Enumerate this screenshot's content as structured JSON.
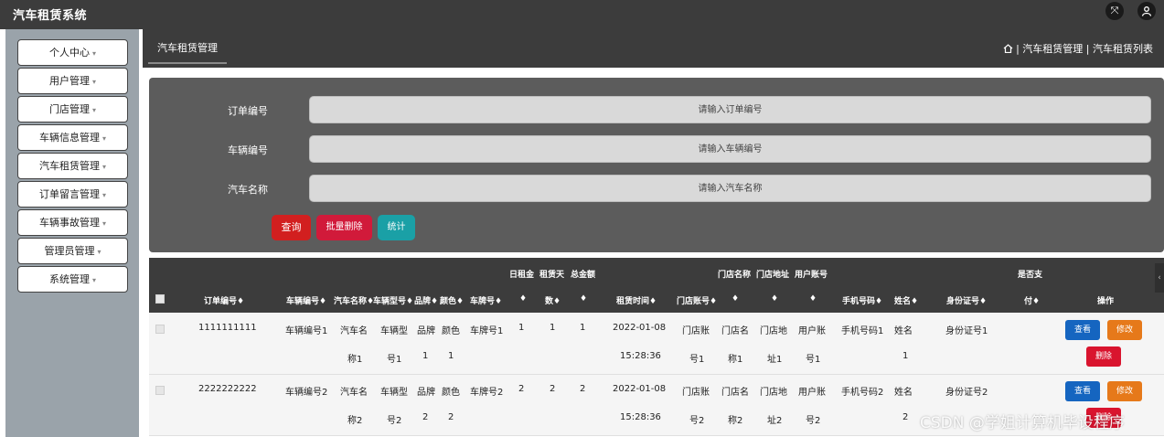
{
  "app": {
    "title": "汽车租赁系统"
  },
  "topbar": {
    "fullscreen_icon": "fullscreen-icon",
    "user_icon": "user-icon"
  },
  "sidebar": {
    "items": [
      {
        "label": "个人中心"
      },
      {
        "label": "用户管理"
      },
      {
        "label": "门店管理"
      },
      {
        "label": "车辆信息管理"
      },
      {
        "label": "汽车租赁管理"
      },
      {
        "label": "订单留言管理"
      },
      {
        "label": "车辆事故管理"
      },
      {
        "label": "管理员管理"
      },
      {
        "label": "系统管理"
      }
    ],
    "caret": "▾"
  },
  "tab": {
    "label": "汽车租赁管理"
  },
  "breadcrumb": {
    "sep": "|",
    "level1": "汽车租赁管理",
    "level2": "汽车租赁列表"
  },
  "search": {
    "order_label": "订单编号",
    "order_placeholder": "请输入订单编号",
    "vehicle_label": "车辆编号",
    "vehicle_placeholder": "请输入车辆编号",
    "car_name_label": "汽车名称",
    "car_name_placeholder": "请输入汽车名称",
    "query_button": "查询",
    "batch_delete_button": "批量删除",
    "stats_button": "统计"
  },
  "table": {
    "headers": {
      "daily_rent": "日租金",
      "rent_days": "租赁天",
      "total": "总金额",
      "store_name": "门店名称",
      "store_addr": "门店地址",
      "user_acct": "用户账号",
      "paid": "是否支",
      "order_no": "订单编号",
      "vehicle_no": "车辆编号",
      "car_name": "汽车名称",
      "car_model": "车辆型号",
      "brand": "品牌",
      "color": "颜色",
      "plate": "车牌号",
      "days_suffix": "数",
      "rent_time": "租赁时间",
      "store_acct": "门店账号",
      "phone": "手机号码",
      "name": "姓名",
      "id_no": "身份证号",
      "paid_suffix": "付",
      "ops": "操作",
      "sort": "♦"
    },
    "rows": [
      {
        "order_no": "1111111111",
        "vehicle_no": "车辆编号1",
        "car_name_a": "汽车名",
        "car_name_b": "称1",
        "model_a": "车辆型",
        "model_b": "号1",
        "brand_a": "品牌",
        "brand_b": "1",
        "color_a": "颜色",
        "color_b": "1",
        "plate": "车牌号1",
        "daily": "1",
        "days": "1",
        "total": "1",
        "date": "2022-01-08",
        "time": "15:28:36",
        "sacct_a": "门店账",
        "sacct_b": "号1",
        "sname_a": "门店名",
        "sname_b": "称1",
        "saddr_a": "门店地",
        "saddr_b": "址1",
        "uacct_a": "用户账",
        "uacct_b": "号1",
        "phone": "手机号码1",
        "name_a": "姓名",
        "name_b": "1",
        "id_no": "身份证号1"
      },
      {
        "order_no": "2222222222",
        "vehicle_no": "车辆编号2",
        "car_name_a": "汽车名",
        "car_name_b": "称2",
        "model_a": "车辆型",
        "model_b": "号2",
        "brand_a": "品牌",
        "brand_b": "2",
        "color_a": "颜色",
        "color_b": "2",
        "plate": "车牌号2",
        "daily": "2",
        "days": "2",
        "total": "2",
        "date": "2022-01-08",
        "time": "15:28:36",
        "sacct_a": "门店账",
        "sacct_b": "号2",
        "sname_a": "门店名",
        "sname_b": "称2",
        "saddr_a": "门店地",
        "saddr_b": "址2",
        "uacct_a": "用户账",
        "uacct_b": "号2",
        "phone": "手机号码2",
        "name_a": "姓名",
        "name_b": "2",
        "id_no": "身份证号2"
      }
    ],
    "actions": {
      "view": "查看",
      "edit": "修改",
      "delete": "删除"
    }
  },
  "watermark": "CSDN @学姐计算机毕设程序",
  "colors": {
    "topbar": "#3c3c3c",
    "sidebar": "#9aa3aa",
    "search_panel": "#5c5c5c",
    "query": "#d21f1f",
    "batch_delete": "#d11a3a",
    "stats": "#1aa0a6",
    "view": "#1565c0",
    "edit": "#e6791a",
    "delete": "#d9142e"
  }
}
